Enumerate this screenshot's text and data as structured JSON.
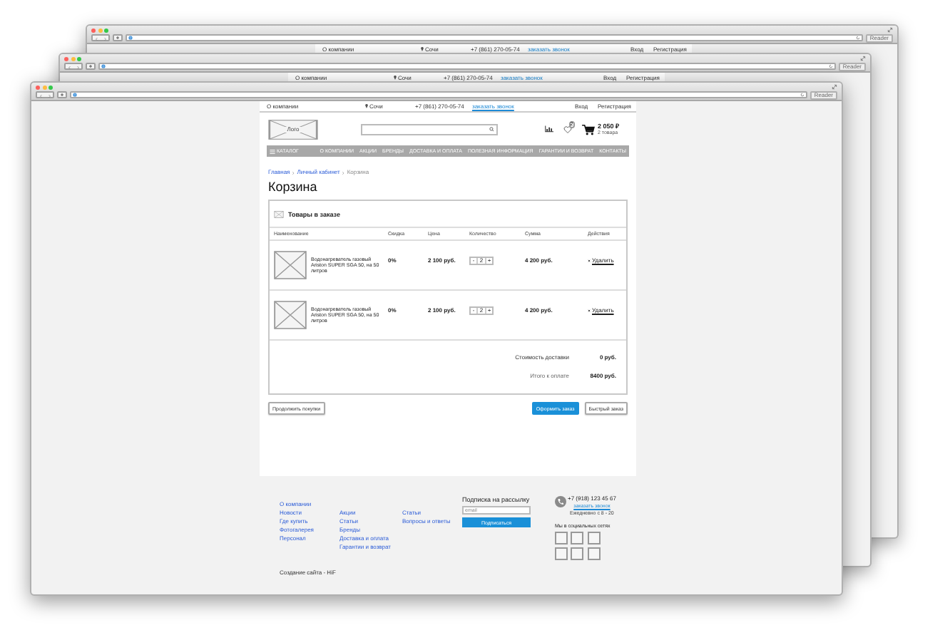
{
  "windows": [
    {
      "kind": "back",
      "reader": "Reader",
      "topbar": [
        {
          "text": "О компании",
          "kind": "text"
        },
        {
          "text": "Сочи",
          "kind": "city"
        },
        {
          "text": "+7 (861) 270-05-74",
          "kind": "text"
        },
        {
          "text": "заказать звонок",
          "kind": "link"
        },
        {
          "text": "Вход",
          "kind": "text"
        },
        {
          "text": "Регистрация",
          "kind": "text"
        }
      ]
    },
    {
      "kind": "middle",
      "reader": "Reader",
      "topbar": [
        {
          "text": "О компании",
          "kind": "text"
        },
        {
          "text": "Сочи",
          "kind": "city"
        },
        {
          "text": "+7 (861) 270-05-74",
          "kind": "text"
        },
        {
          "text": "заказать звонок",
          "kind": "link"
        },
        {
          "text": "Вход",
          "kind": "text"
        },
        {
          "text": "Регистрация",
          "kind": "text"
        }
      ]
    }
  ],
  "browser": {
    "reader": "Reader"
  },
  "page": {
    "topbar": [
      {
        "text": "О компании",
        "kind": "text"
      },
      {
        "text": "Сочи",
        "kind": "city"
      },
      {
        "text": "+7 (861) 270-05-74",
        "kind": "text"
      },
      {
        "text": "заказать звонок",
        "kind": "link"
      },
      {
        "text": "Вход",
        "kind": "text"
      },
      {
        "text": "Регистрация",
        "kind": "text"
      }
    ],
    "logo": "Лого",
    "wishlist_badge": "2",
    "cart": {
      "total": "2 050 ₽",
      "count": "2 товара"
    },
    "nav": {
      "catalog": "КАТАЛОГ",
      "items": [
        "О КОМПАНИИ",
        "АКЦИИ",
        "БРЕНДЫ",
        "ДОСТАВКА И ОПЛАТА",
        "ПОЛЕЗНАЯ ИНФОРМАЦИЯ",
        "ГАРАНТИИ И ВОЗВРАТ",
        "КОНТАКТЫ"
      ]
    },
    "breadcrumbs": [
      {
        "text": "Главная",
        "current": false
      },
      {
        "text": "Личный кабинет",
        "current": false
      },
      {
        "text": "Корзина",
        "current": true
      }
    ],
    "title": "Корзина",
    "cart_table": {
      "heading": "Товары в заказе",
      "columns": [
        "Наименование",
        "Скидка",
        "Цена",
        "Количество",
        "Сумма",
        "Действия"
      ],
      "rows": [
        {
          "name": "Водонагреватель газовый Ariston SUPER SGA 50, на 50 литров",
          "discount": "0%",
          "price": "2 100 руб.",
          "quantity": {
            "minus": "-",
            "value": "2",
            "plus": "+"
          },
          "sum": "4 200 руб.",
          "action": "Удалить"
        },
        {
          "name": "Водонагреватель газовый Ariston SUPER SGA 50, на 50 литров",
          "discount": "0%",
          "price": "2 100 руб.",
          "quantity": {
            "minus": "-",
            "value": "2",
            "plus": "+"
          },
          "sum": "4 200 руб.",
          "action": "Удалить"
        }
      ],
      "totals": [
        {
          "label": "Стоимость доставки",
          "value": "0 руб."
        },
        {
          "label": "Итого к оплате",
          "value": "8400 руб."
        }
      ]
    },
    "buttons": [
      {
        "label": "Продолжить покупки",
        "kind": "outline"
      },
      {
        "label": "Оформить заказ",
        "kind": "primary"
      },
      {
        "label": "Быстрый заказ",
        "kind": "outline"
      }
    ],
    "footer": {
      "link_columns": [
        [
          "О компании",
          "Новости",
          "Где купить",
          "Фотогалерея",
          "Персонал"
        ],
        [
          "Акции",
          "Статьи",
          "Бренды",
          "Доставка и оплата",
          "Гарантии и возврат"
        ],
        [
          "Статьи",
          "Вопросы и ответы"
        ]
      ],
      "subscribe": {
        "title": "Подписка на рассылку",
        "placeholder": "email",
        "button": "Подписаться"
      },
      "contacts": {
        "phone": "+7 (918) 123 45 67",
        "callback": "заказать звонок",
        "hours": "Ежедневно с 8 - 20"
      },
      "social": {
        "title": "Мы в социальных сетях"
      },
      "credit": "Создание сайта - HiF"
    }
  }
}
